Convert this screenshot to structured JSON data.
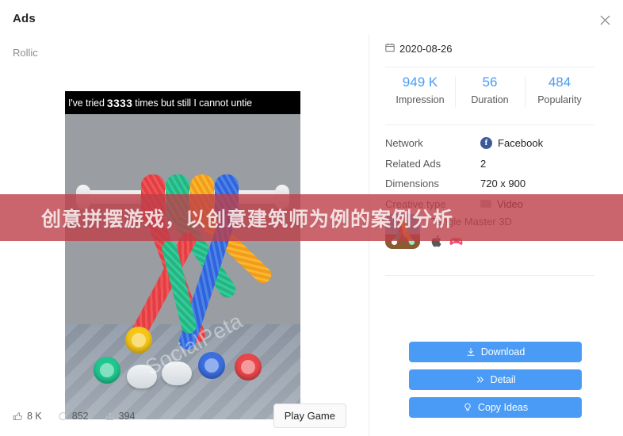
{
  "header": {
    "title": "Ads",
    "close_icon": "close-icon"
  },
  "left": {
    "advertiser": "Rollic",
    "creative": {
      "caption_prefix": "I've tried",
      "caption_number": "3333",
      "caption_suffix": "times but still I cannot untie",
      "watermark": "SocialPeta"
    },
    "social": [
      {
        "icon": "thumbs-up-icon",
        "value": "8 K"
      },
      {
        "icon": "comment-icon",
        "value": "852"
      },
      {
        "icon": "share-icon",
        "value": "394"
      }
    ],
    "play_game_label": "Play Game"
  },
  "right": {
    "date_icon": "calendar-icon",
    "date": "2020-08-26",
    "stats": [
      {
        "value": "949 K",
        "label": "Impression"
      },
      {
        "value": "56",
        "label": "Duration"
      },
      {
        "value": "484",
        "label": "Popularity"
      }
    ],
    "meta": [
      {
        "key": "Network",
        "value": "Facebook",
        "icon": "facebook-icon"
      },
      {
        "key": "Related Ads",
        "value": "2",
        "icon": ""
      },
      {
        "key": "Dimensions",
        "value": "720 x 900",
        "icon": ""
      },
      {
        "key": "Creative type",
        "value": "Video",
        "icon": "video-icon"
      }
    ],
    "app": {
      "name": "Tangle Master 3D",
      "platforms": [
        "apple-icon",
        "gamepad-icon"
      ]
    },
    "buttons": [
      {
        "label": "Download",
        "icon": "download-icon"
      },
      {
        "label": "Detail",
        "icon": "chevron-double-right-icon"
      },
      {
        "label": "Copy Ideas",
        "icon": "lightbulb-icon"
      }
    ]
  },
  "banner": {
    "text": "创意拼摆游戏，以创意建筑师为例的案例分析",
    "color": "#be3e48"
  },
  "colors": {
    "accent": "#4a9bf5",
    "facebook": "#3b5998",
    "banner": "#be3e48"
  }
}
